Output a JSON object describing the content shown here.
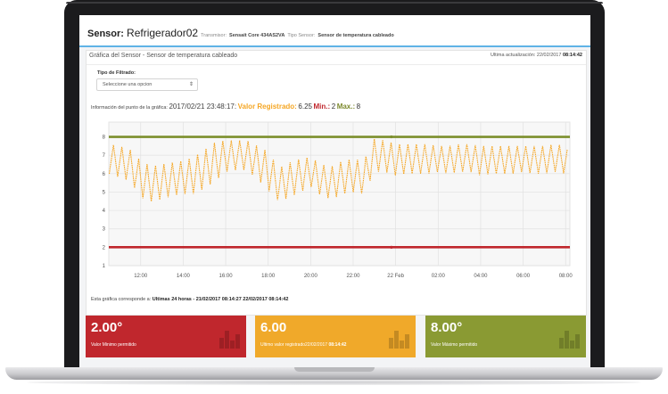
{
  "header": {
    "sensor_label": "Sensor:",
    "sensor_name": "Refrigerador02",
    "transmitter_label": "Transmisor:",
    "transmitter_value": "Sensait Core 434AS2VA",
    "type_label": "Tipo Sensor:",
    "type_value": "Sensor de temperatura cableado"
  },
  "panel": {
    "title": "Gráfica del Sensor - Sensor de temperatura cableado",
    "last_update_label": "Ultima actualización: 22/02/2017",
    "last_update_time": "08:14:42"
  },
  "filter": {
    "label": "Tipo de Filtrado:",
    "selected": "Seleccione una opcion"
  },
  "info": {
    "label": "Información del punto de la gráfica:",
    "datetime": "2017/02/21 23:48:17:",
    "value_label": "Valor Registrado:",
    "value": "6.25",
    "min_label": "Min.:",
    "min_value": "2",
    "max_label": "Max.:",
    "max_value": "8"
  },
  "note": {
    "prefix": "Esta gráfica corresponde a:",
    "range": "Ultimas 24 horas - 21/02/2017 08:14:27 22/02/2017 08:14:42"
  },
  "cards": [
    {
      "value": "2.00°",
      "label": "Valor Minimo permitido",
      "label_bold": "",
      "color": "#c0272d"
    },
    {
      "value": "6.00",
      "label": "Ultimo valor registrado22/02/2017",
      "label_bold": "08:14:42",
      "color": "#f0a92a"
    },
    {
      "value": "8.00°",
      "label": "Valor Máximo permitido",
      "label_bold": "",
      "color": "#8a9a33"
    }
  ],
  "chart_data": {
    "type": "line",
    "x_ticks": [
      "12:00",
      "14:00",
      "16:00",
      "18:00",
      "20:00",
      "22:00",
      "22 Feb",
      "02:00",
      "04:00",
      "06:00",
      "08:00"
    ],
    "y_ticks": [
      1,
      2,
      3,
      4,
      5,
      6,
      7,
      8
    ],
    "ylim": [
      1,
      8.8
    ],
    "grid": true,
    "series": [
      {
        "color": "#7c8f2c",
        "constant": 8
      },
      {
        "color": "#c0272d",
        "constant": 2
      },
      {
        "color": "#f5a623",
        "x": [
          10.5,
          11.0,
          11.5,
          12.0,
          12.5,
          13.0,
          13.5,
          14.0,
          14.5,
          15.0,
          15.5,
          16.0,
          16.5,
          17.0,
          17.5,
          18.0,
          18.5,
          19.0,
          19.5,
          20.0,
          20.5,
          21.0,
          21.5,
          22.0,
          22.5,
          23.0,
          23.5,
          24.0,
          24.5,
          25.0,
          25.5,
          26.0,
          26.5,
          27.0,
          27.5,
          28.0,
          28.5,
          29.0,
          29.5,
          30.0,
          30.5,
          31.0,
          31.5,
          32.0
        ],
        "lower": [
          6.0,
          5.8,
          5.6,
          4.7,
          4.5,
          4.6,
          4.8,
          4.9,
          4.9,
          5.2,
          5.6,
          6.1,
          6.2,
          6.2,
          5.7,
          5.1,
          4.5,
          4.7,
          5.0,
          5.3,
          4.8,
          4.6,
          4.9,
          5.0,
          4.9,
          6.1,
          6.1,
          5.9,
          6.0,
          6.0,
          6.0,
          6.1,
          6.0,
          6.1,
          6.1,
          5.9,
          6.0,
          6.0,
          6.0,
          6.1,
          6.0,
          6.0,
          6.1,
          6.0
        ],
        "upper": [
          7.6,
          7.5,
          7.3,
          6.7,
          6.4,
          6.5,
          6.6,
          6.7,
          6.9,
          7.3,
          7.7,
          7.8,
          7.8,
          7.8,
          7.5,
          7.2,
          6.3,
          6.6,
          6.8,
          6.9,
          6.5,
          6.4,
          6.7,
          6.8,
          6.7,
          7.9,
          7.8,
          7.6,
          7.6,
          7.6,
          7.6,
          7.5,
          7.5,
          7.6,
          7.6,
          7.5,
          7.5,
          7.5,
          7.5,
          7.5,
          7.5,
          7.5,
          7.6,
          7.5
        ]
      }
    ]
  }
}
